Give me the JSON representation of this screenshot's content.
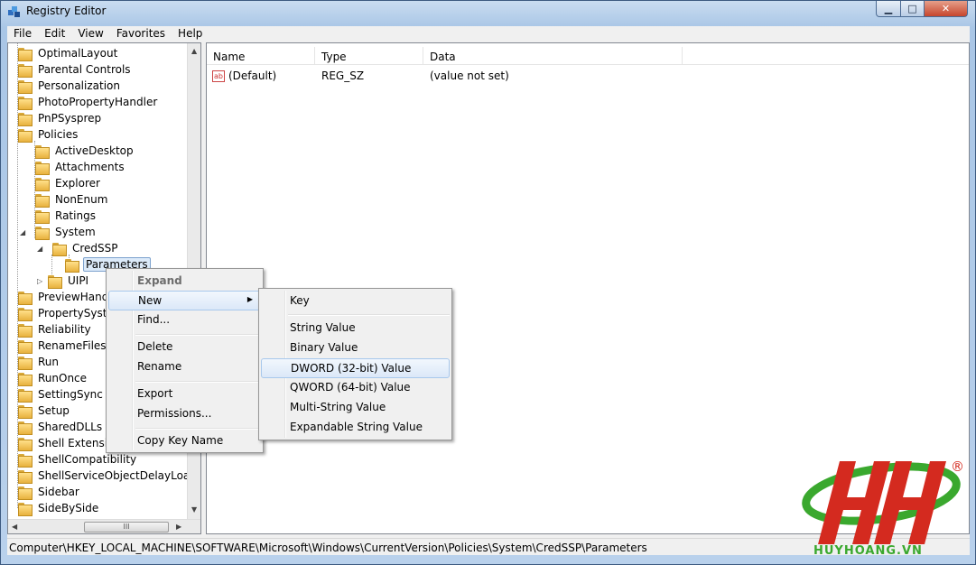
{
  "window": {
    "title": "Registry Editor"
  },
  "menubar": [
    "File",
    "Edit",
    "View",
    "Favorites",
    "Help"
  ],
  "tree": {
    "top_items": [
      "OptimalLayout",
      "Parental Controls",
      "Personalization",
      "PhotoPropertyHandler",
      "PnPSysprep",
      "Policies"
    ],
    "policies_children": [
      "ActiveDesktop",
      "Attachments",
      "Explorer",
      "NonEnum",
      "Ratings",
      "System"
    ],
    "system_children": [
      "CredSSP",
      "UIPI"
    ],
    "credssp_children": [
      "Parameters"
    ],
    "bottom_items": [
      "PreviewHandlers",
      "PropertySystem",
      "Reliability",
      "RenameFiles",
      "Run",
      "RunOnce",
      "SettingSync",
      "Setup",
      "SharedDLLs",
      "Shell Extensions",
      "ShellCompatibility",
      "ShellServiceObjectDelayLoad",
      "Sidebar",
      "SideBySide"
    ],
    "scroll_thumb_glyph": "III"
  },
  "listview": {
    "columns": [
      "Name",
      "Type",
      "Data"
    ],
    "rows": [
      {
        "name": "(Default)",
        "type": "REG_SZ",
        "data": "(value not set)"
      }
    ],
    "icon_text": "ab"
  },
  "context_menu": {
    "items": [
      "Expand",
      "New",
      "Find...",
      "Delete",
      "Rename",
      "Export",
      "Permissions...",
      "Copy Key Name"
    ],
    "submenu_arrow": "▶"
  },
  "new_submenu": {
    "items": [
      "Key",
      "String Value",
      "Binary Value",
      "DWORD (32-bit) Value",
      "QWORD (64-bit) Value",
      "Multi-String Value",
      "Expandable String Value"
    ],
    "highlighted": "DWORD (32-bit) Value"
  },
  "statusbar": {
    "path": "Computer\\HKEY_LOCAL_MACHINE\\SOFTWARE\\Microsoft\\Windows\\CurrentVersion\\Policies\\System\\CredSSP\\Parameters"
  },
  "watermark": {
    "text": "HUYHOANG.VN",
    "reg": "®",
    "colors": {
      "red": "#d42a1f",
      "green": "#3aa82e"
    }
  }
}
